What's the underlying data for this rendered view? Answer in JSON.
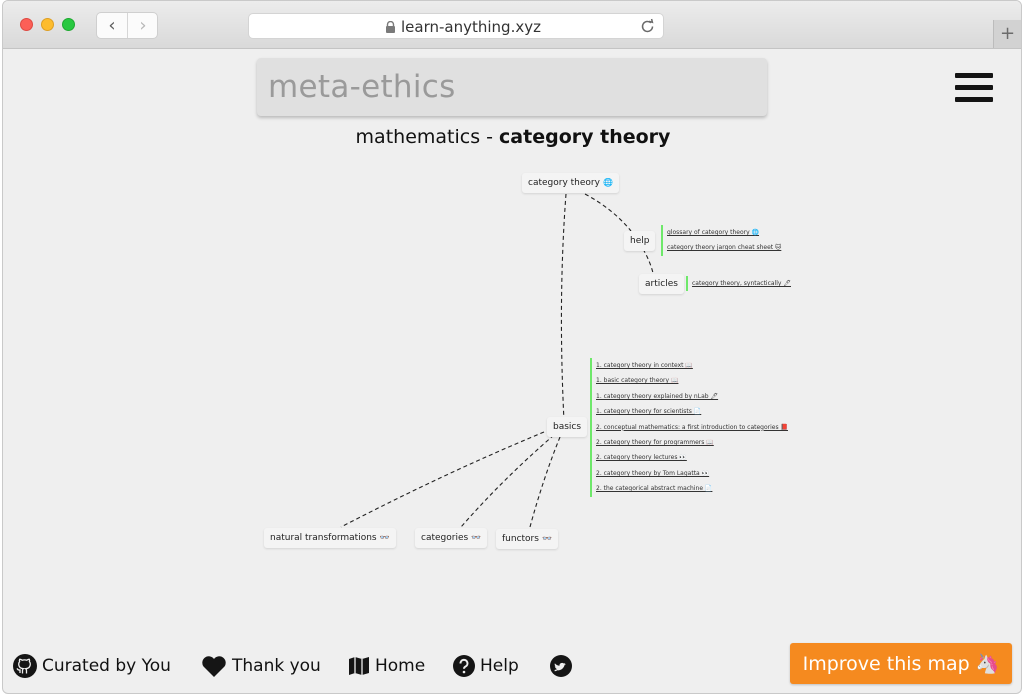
{
  "browser": {
    "url": "learn-anything.xyz",
    "back_label": "‹",
    "forward_label": "›",
    "new_tab_label": "+"
  },
  "search": {
    "value": "meta-ethics"
  },
  "heading": {
    "topic": "mathematics",
    "separator": " - ",
    "subject": "category theory"
  },
  "map": {
    "nodes": {
      "root": {
        "label": "category theory",
        "icon": "🌐"
      },
      "help": {
        "label": "help"
      },
      "articles": {
        "label": "articles"
      },
      "basics": {
        "label": "basics"
      },
      "natural_transformations": {
        "label": "natural transformations",
        "icon": "👓"
      },
      "categories": {
        "label": "categories",
        "icon": "👓"
      },
      "functors": {
        "label": "functors",
        "icon": "👓"
      }
    },
    "help_links": [
      "glossary of category theory 🌐",
      "category theory jargon cheat sheet 🐱"
    ],
    "article_links": [
      "category theory, syntactically 🖊"
    ],
    "basics_links": [
      "1. category theory in context 📖",
      "1. basic category theory 📖",
      "1. category theory explained by nLab 🖊",
      "1. category theory for scientists 📄",
      "2. conceptual mathematics: a first introduction to categories 📕",
      "2. category theory for programmers 📖",
      "2. category theory lectures 👀",
      "2. category theory by Tom Lagatta 👀",
      "2. the categorical abstract machine 📄"
    ]
  },
  "footer": {
    "curated": "Curated by You",
    "thanks": "Thank you",
    "home": "Home",
    "help": "Help",
    "improve": "Improve this map 🦄"
  },
  "colors": {
    "accent_orange": "#f58a1f",
    "leaf_border_green": "#6ee86a",
    "background": "#efefef"
  },
  "icons": [
    "lock-icon",
    "reload-icon",
    "menu-icon",
    "github-icon",
    "heart-icon",
    "map-icon",
    "help-icon",
    "twitter-icon"
  ]
}
